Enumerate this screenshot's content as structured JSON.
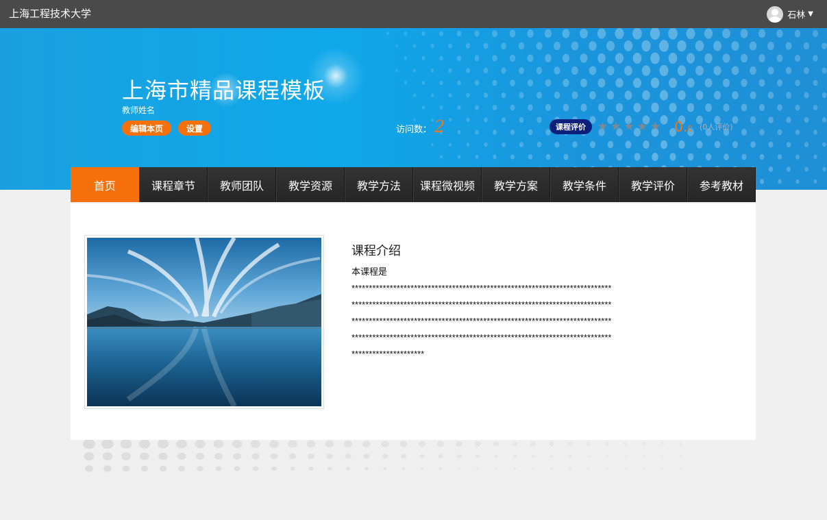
{
  "topbar": {
    "school_name": "上海工程技术大学",
    "user_name": "石林",
    "user_icon": "avatar-icon",
    "dropdown_icon": "chevron-down-icon"
  },
  "banner": {
    "course_title": "上海市精品课程模板",
    "teacher_name": "教师姓名",
    "edit_button": "编辑本页",
    "settings_button": "设置",
    "visits_label": "访问数：",
    "visits_count": "2",
    "rating_label": "课程评价",
    "stars_filled": 0,
    "stars_total": 5,
    "score_main": "0.",
    "score_decimal": "0",
    "rating_count": "(0人评价)"
  },
  "nav": {
    "items": [
      "首页",
      "课程章节",
      "教师团队",
      "教学资源",
      "教学方法",
      "课程微视频",
      "教学方案",
      "教学条件",
      "教学评价",
      "参考教材"
    ],
    "active_index": 0
  },
  "content": {
    "intro_title": "课程介绍",
    "intro_lead": "本课程是",
    "intro_lines": [
      "***************************************************************************",
      "***************************************************************************",
      "***************************************************************************",
      "***************************************************************************",
      "*********************"
    ]
  },
  "colors": {
    "accent_orange": "#f6700b",
    "topbar": "#4a4a4a",
    "nav_bg": "#2d2d2d",
    "banner_blue": "#0fa8ea",
    "rating_tag": "#0c1f7a"
  }
}
